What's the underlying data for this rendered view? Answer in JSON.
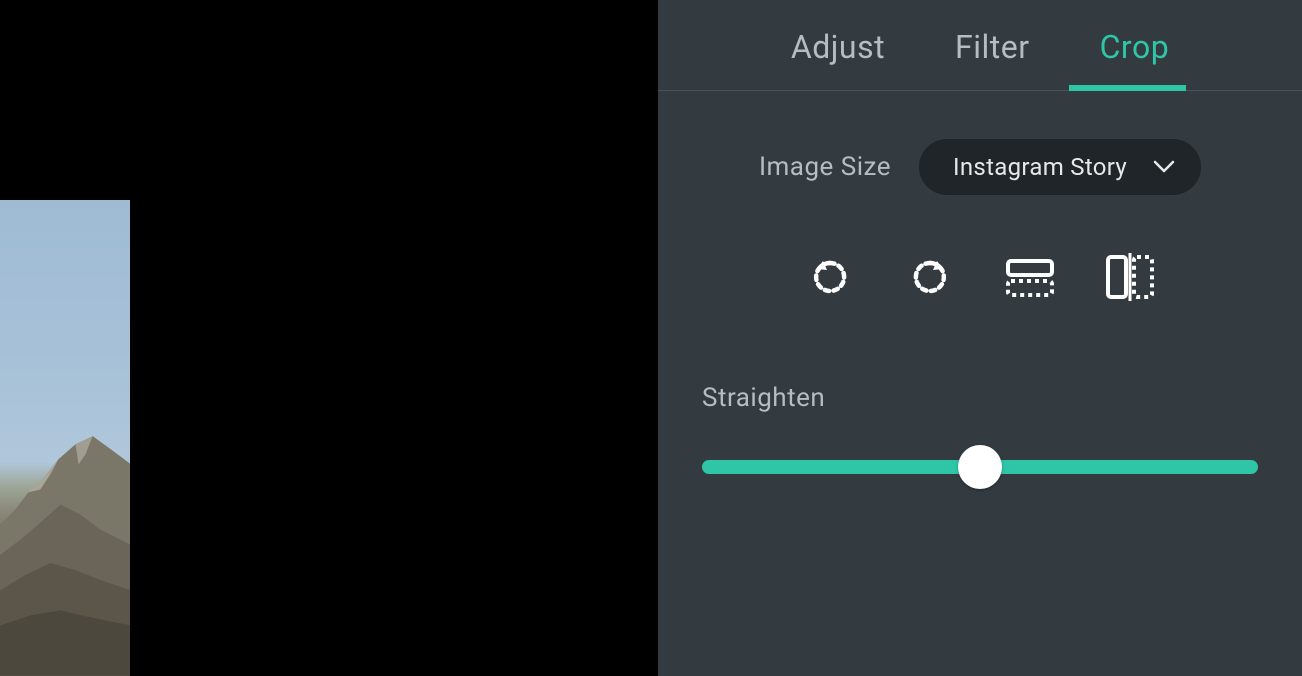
{
  "tabs": {
    "adjust": "Adjust",
    "filter": "Filter",
    "crop": "Crop",
    "active": "crop"
  },
  "imageSize": {
    "label": "Image Size",
    "selected": "Instagram Story"
  },
  "tools": {
    "rotateLeft": "rotate-left-icon",
    "rotateRight": "rotate-right-icon",
    "flipHorizontal": "flip-horizontal-icon",
    "flipVertical": "flip-vertical-icon"
  },
  "straighten": {
    "label": "Straighten",
    "value": 50,
    "min": 0,
    "max": 100
  },
  "colors": {
    "accent": "#2fc6a8",
    "panelBg": "#333b40",
    "selectBg": "#1f2528",
    "textMuted": "#b6bcc0",
    "textLight": "#e6e8ea"
  }
}
